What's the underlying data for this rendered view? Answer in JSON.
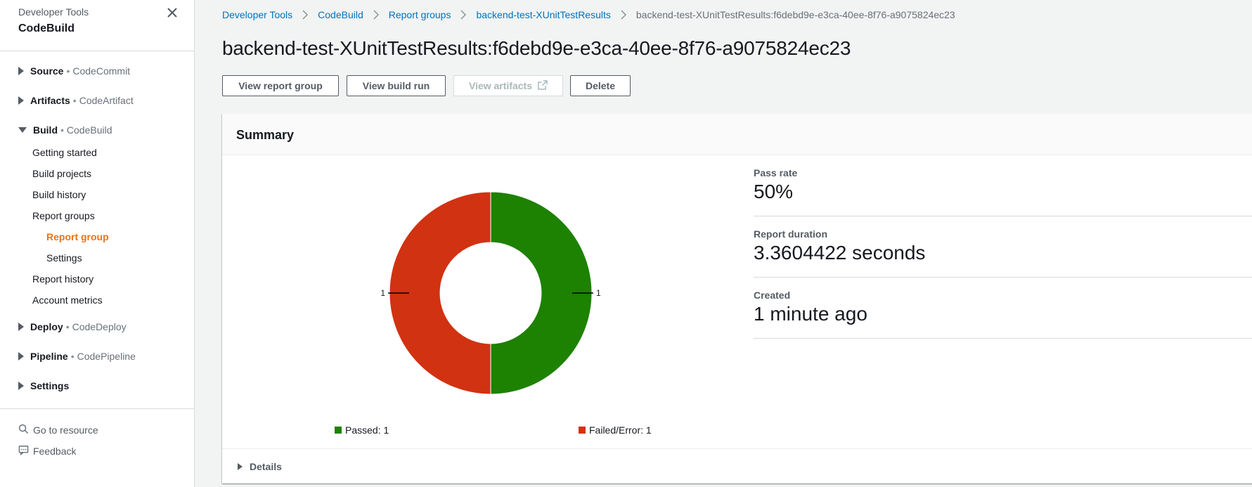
{
  "sidebar": {
    "service": "Developer Tools",
    "title": "CodeBuild",
    "groups": [
      {
        "name": "Source",
        "sub": "CodeCommit"
      },
      {
        "name": "Artifacts",
        "sub": "CodeArtifact"
      },
      {
        "name": "Build",
        "sub": "CodeBuild"
      },
      {
        "name": "Deploy",
        "sub": "CodeDeploy"
      },
      {
        "name": "Pipeline",
        "sub": "CodePipeline"
      },
      {
        "name": "Settings",
        "sub": ""
      }
    ],
    "separator": "•",
    "build_items": [
      "Getting started",
      "Build projects",
      "Build history",
      "Report groups",
      "Report group",
      "Settings",
      "Report history",
      "Account metrics"
    ],
    "utilities": {
      "go_to_resource": "Go to resource",
      "feedback": "Feedback"
    }
  },
  "breadcrumb": [
    "Developer Tools",
    "CodeBuild",
    "Report groups",
    "backend-test-XUnitTestResults",
    "backend-test-XUnitTestResults:f6debd9e-e3ca-40ee-8f76-a9075824ec23"
  ],
  "page": {
    "title": "backend-test-XUnitTestResults:f6debd9e-e3ca-40ee-8f76-a9075824ec23",
    "buttons": {
      "view_report_group": "View report group",
      "view_build_run": "View build run",
      "view_artifacts": "View artifacts",
      "delete": "Delete"
    }
  },
  "summary": {
    "title": "Summary",
    "pass_rate_label": "Pass rate",
    "pass_rate_value": "50%",
    "duration_label": "Report duration",
    "duration_value": "3.3604422 seconds",
    "created_label": "Created",
    "created_value": "1 minute ago",
    "details_label": "Details"
  },
  "chart_data": {
    "type": "pie",
    "categories": [
      "Passed",
      "Failed/Error"
    ],
    "values": [
      1,
      1
    ],
    "colors": [
      "#1d8102",
      "#d13212"
    ],
    "legend": [
      "Passed: 1",
      "Failed/Error: 1"
    ],
    "slice_labels": [
      "1",
      "1"
    ]
  },
  "colors": {
    "link": "#0073bb",
    "active_nav": "#ec7211"
  }
}
